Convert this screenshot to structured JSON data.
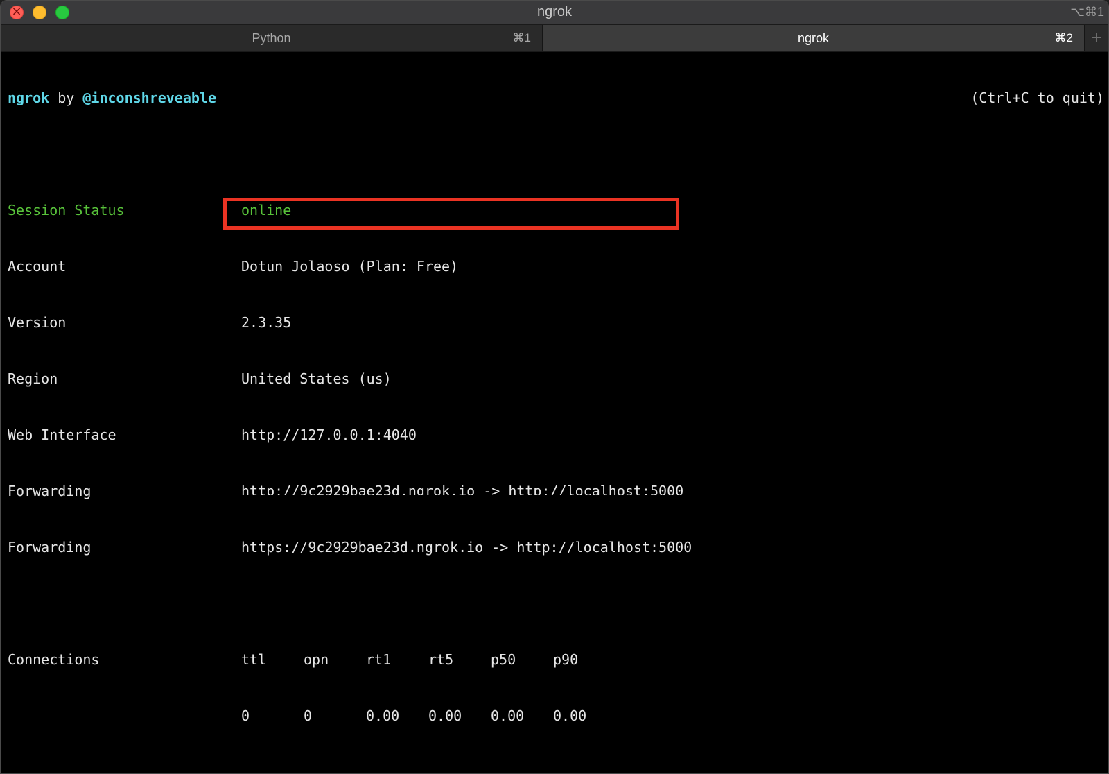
{
  "window": {
    "title": "ngrok",
    "shortcut": "⌥⌘1",
    "tabs": [
      {
        "label": "Python",
        "key": "⌘1",
        "active": false
      },
      {
        "label": "ngrok",
        "key": "⌘2",
        "active": true
      }
    ],
    "add_tab_symbol": "+"
  },
  "terminal": {
    "header": {
      "app": "ngrok",
      "by": " by ",
      "author": "@inconshreveable",
      "quit_hint": "(Ctrl+C to quit)"
    },
    "status": {
      "label": "Session Status",
      "value": "online"
    },
    "rows": [
      {
        "label": "Account",
        "value": "Dotun Jolaoso (Plan: Free)"
      },
      {
        "label": "Version",
        "value": "2.3.35"
      },
      {
        "label": "Region",
        "value": "United States (us)"
      },
      {
        "label": "Web Interface",
        "value": "http://127.0.0.1:4040"
      },
      {
        "label": "Forwarding",
        "value": "http://9c2929bae23d.ngrok.io -> http://localhost:5000"
      },
      {
        "label": "Forwarding",
        "value": "https://9c2929bae23d.ngrok.io -> http://localhost:5000"
      }
    ],
    "connections": {
      "label": "Connections",
      "columns": [
        "ttl",
        "opn",
        "rt1",
        "rt5",
        "p50",
        "p90"
      ],
      "values": [
        "0",
        "0",
        "0.00",
        "0.00",
        "0.00",
        "0.00"
      ]
    }
  },
  "colors": {
    "accent_cyan": "#5fd7e8",
    "status_green": "#58c23a",
    "highlight_red": "#ea3323"
  }
}
